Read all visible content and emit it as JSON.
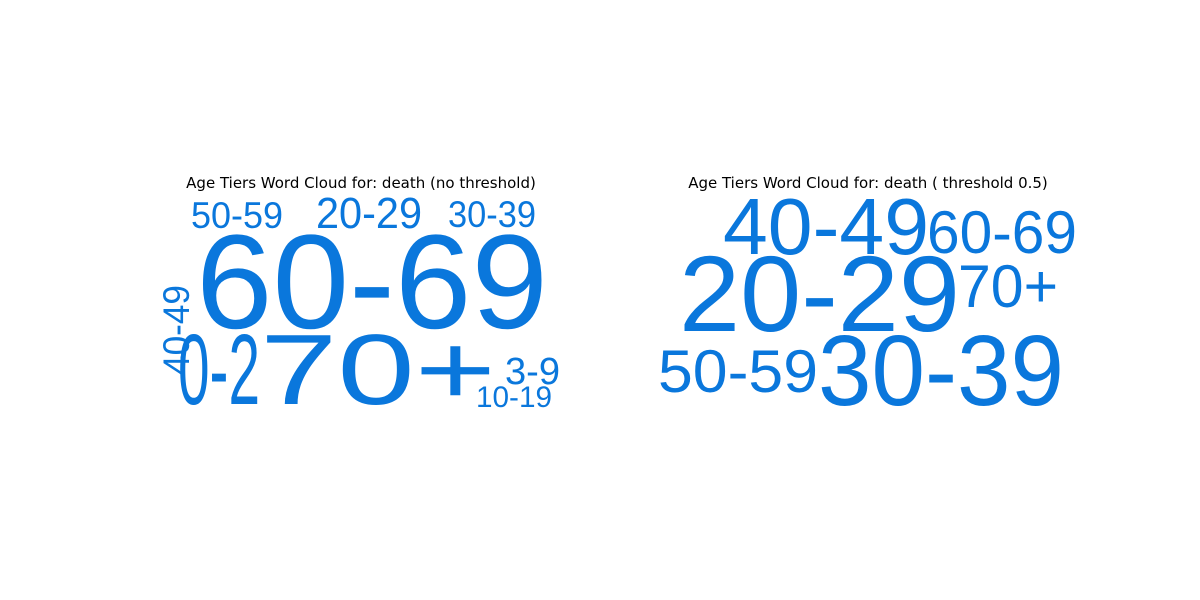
{
  "chart_data": [
    {
      "type": "wordcloud",
      "title": "Age Tiers Word Cloud for: death (no threshold)",
      "word_color": "#0a77dc",
      "words": [
        {
          "text": "60-69",
          "size_rank": 1,
          "rotated": false
        },
        {
          "text": "0-2",
          "size_rank": 2,
          "rotated": false
        },
        {
          "text": "70+",
          "size_rank": 2,
          "rotated": false
        },
        {
          "text": "20-29",
          "size_rank": 3,
          "rotated": false
        },
        {
          "text": "50-59",
          "size_rank": 4,
          "rotated": false
        },
        {
          "text": "30-39",
          "size_rank": 4,
          "rotated": false
        },
        {
          "text": "40-49",
          "size_rank": 4,
          "rotated": true
        },
        {
          "text": "3-9",
          "size_rank": 4,
          "rotated": false
        },
        {
          "text": "10-19",
          "size_rank": 5,
          "rotated": false
        }
      ]
    },
    {
      "type": "wordcloud",
      "title": "Age Tiers Word Cloud for: death ( threshold 0.5)",
      "word_color": "#0a77dc",
      "words": [
        {
          "text": "20-29",
          "size_rank": 1,
          "rotated": false
        },
        {
          "text": "30-39",
          "size_rank": 1,
          "rotated": false
        },
        {
          "text": "40-49",
          "size_rank": 2,
          "rotated": false
        },
        {
          "text": "60-69",
          "size_rank": 3,
          "rotated": false
        },
        {
          "text": "50-59",
          "size_rank": 3,
          "rotated": false
        },
        {
          "text": "70+",
          "size_rank": 3,
          "rotated": false
        }
      ]
    }
  ]
}
